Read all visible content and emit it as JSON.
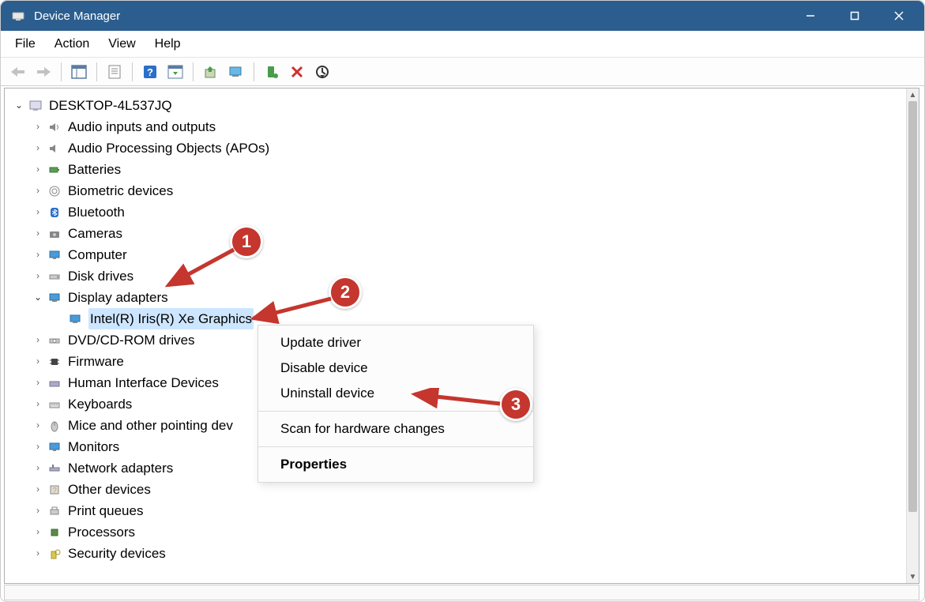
{
  "window": {
    "title": "Device Manager"
  },
  "menubar": {
    "file": "File",
    "action": "Action",
    "view": "View",
    "help": "Help"
  },
  "tree": {
    "root": "DESKTOP-4L537JQ",
    "items": [
      {
        "label": "Audio inputs and outputs"
      },
      {
        "label": "Audio Processing Objects (APOs)"
      },
      {
        "label": "Batteries"
      },
      {
        "label": "Biometric devices"
      },
      {
        "label": "Bluetooth"
      },
      {
        "label": "Cameras"
      },
      {
        "label": "Computer"
      },
      {
        "label": "Disk drives"
      },
      {
        "label": "Display adapters",
        "child": "Intel(R) Iris(R) Xe Graphics"
      },
      {
        "label": "DVD/CD-ROM drives"
      },
      {
        "label": "Firmware"
      },
      {
        "label": "Human Interface Devices"
      },
      {
        "label": "Keyboards"
      },
      {
        "label": "Mice and other pointing dev"
      },
      {
        "label": "Monitors"
      },
      {
        "label": "Network adapters"
      },
      {
        "label": "Other devices"
      },
      {
        "label": "Print queues"
      },
      {
        "label": "Processors"
      },
      {
        "label": "Security devices"
      }
    ]
  },
  "contextMenu": {
    "updateDriver": "Update driver",
    "disableDevice": "Disable device",
    "uninstallDevice": "Uninstall device",
    "scanHardware": "Scan for hardware changes",
    "properties": "Properties"
  },
  "annotations": {
    "one": "1",
    "two": "2",
    "three": "3"
  }
}
